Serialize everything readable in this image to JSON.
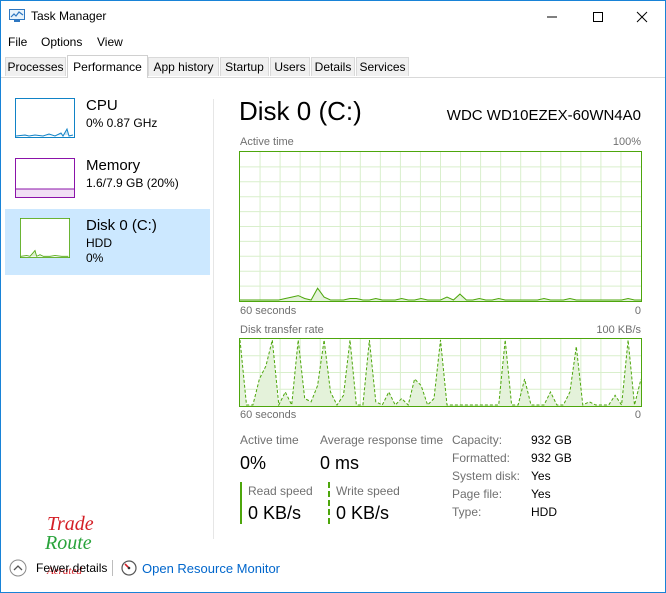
{
  "window": {
    "title": "Task Manager"
  },
  "menu": [
    "File",
    "Options",
    "View"
  ],
  "tabs": [
    "Processes",
    "Performance",
    "App history",
    "Startup",
    "Users",
    "Details",
    "Services"
  ],
  "active_tab": "Performance",
  "sidebar": [
    {
      "name": "CPU",
      "sub1": "0% 0.87 GHz",
      "sub2": ""
    },
    {
      "name": "Memory",
      "sub1": "1.6/7.9 GB (20%)",
      "sub2": ""
    },
    {
      "name": "Disk 0 (C:)",
      "sub1": "HDD",
      "sub2": "0%"
    }
  ],
  "colors": {
    "cpu": "#1183c6",
    "memory": "#8b13a9",
    "disk": "#4da60c",
    "accent": "#cce8ff"
  },
  "main": {
    "title": "Disk 0 (C:)",
    "model": "WDC WD10EZEX-60WN4A0",
    "graph1": {
      "label": "Active time",
      "max": "100%",
      "time": "60 seconds",
      "min": "0"
    },
    "graph2": {
      "label": "Disk transfer rate",
      "max": "100 KB/s",
      "time": "60 seconds",
      "min": "0"
    }
  },
  "active_time_series": [
    0,
    0,
    0,
    0,
    0,
    0,
    0,
    1,
    2,
    3,
    1,
    0,
    8,
    2,
    0,
    0,
    0,
    1,
    1,
    0,
    0,
    1,
    0,
    0,
    0,
    1,
    0,
    0,
    1,
    0,
    0,
    0,
    2,
    0,
    4,
    0,
    0,
    1,
    0,
    0,
    1,
    0,
    0,
    0,
    0,
    0,
    0,
    1,
    0,
    0,
    0,
    1,
    0,
    0,
    0,
    0,
    0,
    0,
    0,
    0,
    1,
    0,
    0
  ],
  "transfer_series": [
    100,
    0,
    0,
    40,
    60,
    100,
    0,
    20,
    0,
    100,
    10,
    5,
    30,
    100,
    20,
    0,
    15,
    100,
    0,
    0,
    100,
    5,
    0,
    20,
    0,
    10,
    0,
    40,
    30,
    0,
    10,
    100,
    0,
    0,
    0,
    0,
    0,
    0,
    0,
    0,
    0,
    100,
    0,
    0,
    40,
    0,
    0,
    0,
    20,
    0,
    0,
    20,
    90,
    0,
    5,
    0,
    0,
    0,
    15,
    0,
    100,
    0,
    40
  ],
  "stats": {
    "active_time_label": "Active time",
    "active_time_value": "0%",
    "response_label": "Average response time",
    "response_value": "0 ms",
    "read_label": "Read speed",
    "read_value": "0 KB/s",
    "write_label": "Write speed",
    "write_value": "0 KB/s"
  },
  "info": [
    {
      "label": "Capacity:",
      "value": "932 GB"
    },
    {
      "label": "Formatted:",
      "value": "932 GB"
    },
    {
      "label": "System disk:",
      "value": "Yes"
    },
    {
      "label": "Page file:",
      "value": "Yes"
    },
    {
      "label": "Type:",
      "value": "HDD"
    }
  ],
  "footer": {
    "fewer_details": "Fewer details",
    "open_monitor": "Open Resource Monitor"
  },
  "watermark": {
    "line1": "Trade",
    "line2": "Route",
    "line3": "Aerated"
  }
}
